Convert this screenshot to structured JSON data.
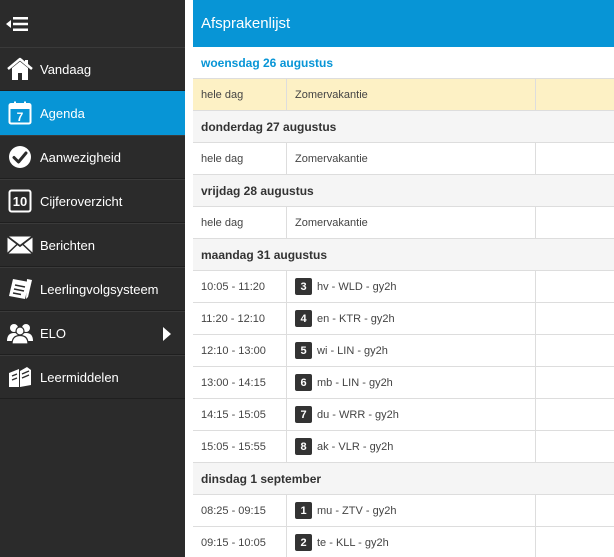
{
  "sidebar": {
    "items": [
      {
        "label": "Vandaag",
        "icon": "home-icon"
      },
      {
        "label": "Agenda",
        "icon": "calendar-icon",
        "icon_text": "7"
      },
      {
        "label": "Aanwezigheid",
        "icon": "checkmark-icon"
      },
      {
        "label": "Cijferoverzicht",
        "icon": "grade-icon",
        "icon_text": "10"
      },
      {
        "label": "Berichten",
        "icon": "envelope-icon"
      },
      {
        "label": "Leerlingvolgsysteem",
        "icon": "notes-icon"
      },
      {
        "label": "ELO",
        "icon": "users-icon"
      },
      {
        "label": "Leermiddelen",
        "icon": "books-icon"
      }
    ]
  },
  "header": {
    "title": "Afsprakenlijst"
  },
  "days": [
    {
      "date": "woensdag 26 augustus",
      "rows": [
        {
          "time": "hele dag",
          "desc": "Zomervakantie"
        }
      ]
    },
    {
      "date": "donderdag 27 augustus",
      "rows": [
        {
          "time": "hele dag",
          "desc": "Zomervakantie"
        }
      ]
    },
    {
      "date": "vrijdag 28 augustus",
      "rows": [
        {
          "time": "hele dag",
          "desc": "Zomervakantie"
        }
      ]
    },
    {
      "date": "maandag 31 augustus",
      "rows": [
        {
          "time": "10:05 - 11:20",
          "hour": "3",
          "desc": "hv - WLD - gy2h"
        },
        {
          "time": "11:20 - 12:10",
          "hour": "4",
          "desc": "en - KTR - gy2h"
        },
        {
          "time": "12:10 - 13:00",
          "hour": "5",
          "desc": "wi - LIN - gy2h"
        },
        {
          "time": "13:00 - 14:15",
          "hour": "6",
          "desc": "mb - LIN - gy2h"
        },
        {
          "time": "14:15 - 15:05",
          "hour": "7",
          "desc": "du - WRR - gy2h"
        },
        {
          "time": "15:05 - 15:55",
          "hour": "8",
          "desc": "ak - VLR - gy2h"
        }
      ]
    },
    {
      "date": "dinsdag 1 september",
      "rows": [
        {
          "time": "08:25 - 09:15",
          "hour": "1",
          "desc": "mu - ZTV - gy2h"
        },
        {
          "time": "09:15 - 10:05",
          "hour": "2",
          "desc": "te - KLL - gy2h"
        }
      ]
    }
  ],
  "colors": {
    "accent": "#0795d6",
    "sidebar": "#2b2b2b",
    "highlight": "#fdf1c5"
  }
}
